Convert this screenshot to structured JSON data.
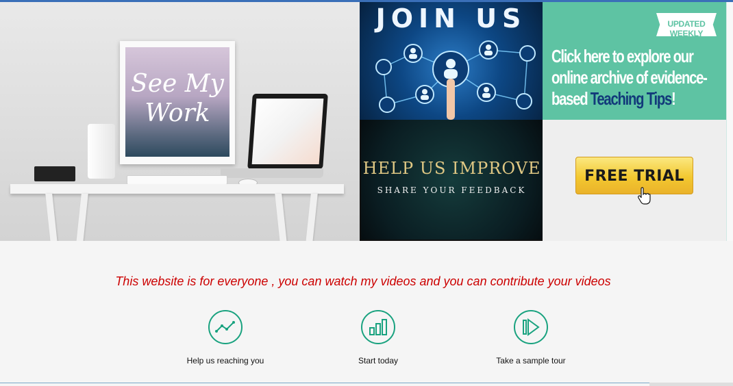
{
  "hero": {
    "art_text": "See My Work",
    "join_title": "JOIN US",
    "tips_badge": "UPDATED WEEKLY",
    "tips_text_before": "Click here to explore our online archive of evidence-based ",
    "tips_text_highlight": "Teaching Tips",
    "tips_text_after": "!",
    "help_title": "HELP US IMPROVE",
    "help_subtitle": "SHARE YOUR FEEDBACK",
    "trial_button": "FREE TRIAL"
  },
  "main": {
    "tagline": "This website is for everyone , you can watch my videos and you can contribute your videos",
    "features": [
      {
        "label": "Help us reaching you",
        "icon": "line-chart-icon"
      },
      {
        "label": "Start today",
        "icon": "bar-chart-icon"
      },
      {
        "label": "Take a sample tour",
        "icon": "play-icon"
      }
    ]
  },
  "colors": {
    "accent_green": "#19a27f",
    "tagline_red": "#cc0000",
    "tips_green": "#5ec3a3",
    "trial_yellow": "#f3c830"
  }
}
